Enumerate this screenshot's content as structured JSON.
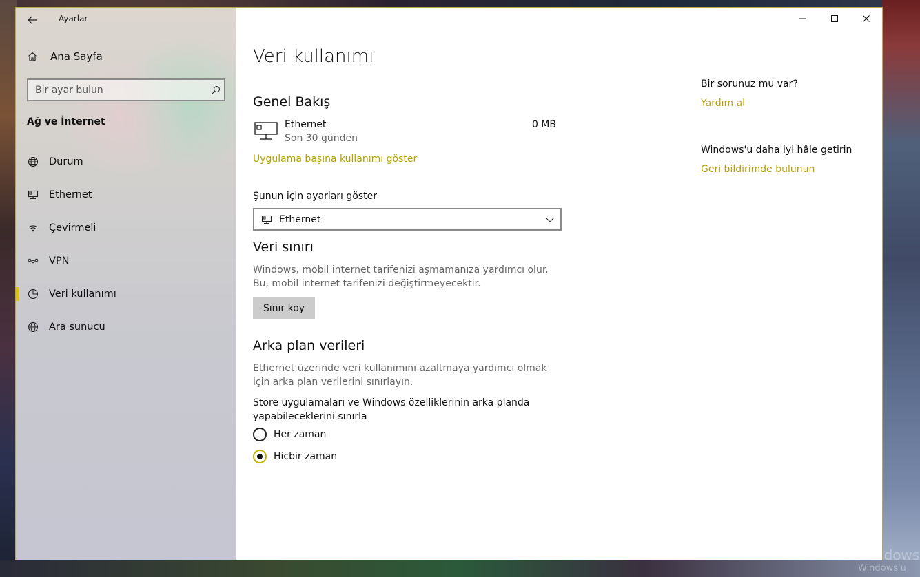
{
  "window": {
    "app_title": "Ayarlar"
  },
  "sidebar": {
    "home_label": "Ana Sayfa",
    "search_placeholder": "Bir ayar bulun",
    "section_title": "Ağ ve İnternet",
    "items": [
      {
        "label": "Durum",
        "icon": "globe-network-icon",
        "active": false
      },
      {
        "label": "Ethernet",
        "icon": "ethernet-icon",
        "active": false
      },
      {
        "label": "Çevirmeli",
        "icon": "dialup-icon",
        "active": false
      },
      {
        "label": "VPN",
        "icon": "vpn-icon",
        "active": false
      },
      {
        "label": "Veri kullanımı",
        "icon": "data-usage-icon",
        "active": true
      },
      {
        "label": "Ara sunucu",
        "icon": "globe-icon",
        "active": false
      }
    ]
  },
  "main": {
    "title": "Veri kullanımı",
    "overview": {
      "heading": "Genel Bakış",
      "connection_name": "Ethernet",
      "period": "Son 30 günden",
      "usage_value": "0 MB",
      "per_app_link": "Uygulama başına kullanımı göster"
    },
    "show_settings_for": {
      "label": "Şunun için ayarları göster",
      "selected": "Ethernet"
    },
    "data_limit": {
      "heading": "Veri sınırı",
      "description": "Windows, mobil internet tarifenizi aşmamanıza yardımcı olur. Bu, mobil internet tarifenizi değiştirmeyecektir.",
      "button_label": "Sınır koy"
    },
    "background_data": {
      "heading": "Arka plan verileri",
      "description": "Ethernet üzerinde veri kullanımını azaltmaya yardımcı olmak için arka plan verilerini sınırlayın.",
      "restrict_label": "Store uygulamaları ve Windows özelliklerinin arka planda yapabileceklerini sınırla",
      "options": [
        {
          "label": "Her zaman",
          "checked": false
        },
        {
          "label": "Hiçbir zaman",
          "checked": true
        }
      ]
    }
  },
  "aside": {
    "question": "Bir sorunuz mu var?",
    "help_link": "Yardım al",
    "improve": "Windows'u daha iyi hâle getirin",
    "feedback_link": "Geri bildirimde bulunun"
  },
  "desktop": {
    "watermark_line1": "Windows'",
    "watermark_line2": "Windows'u"
  },
  "colors": {
    "accent": "#b8a000",
    "active_marker": "#d8c21e"
  }
}
